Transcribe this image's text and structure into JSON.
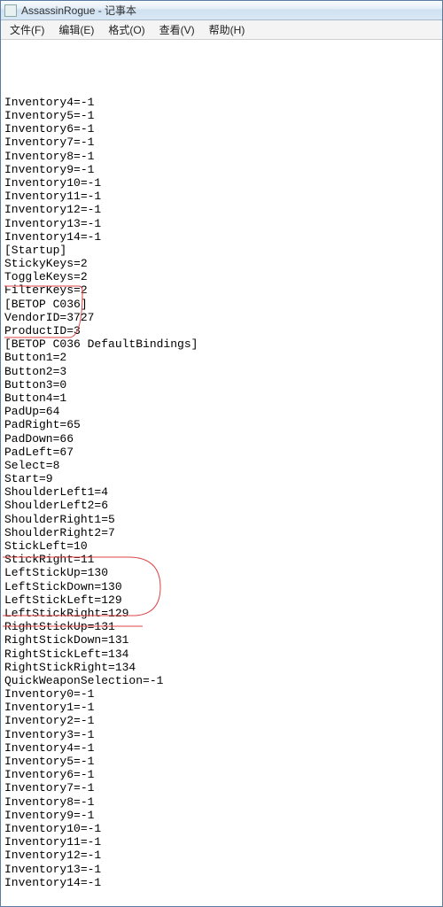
{
  "window": {
    "title": "AssassinRogue - 记事本"
  },
  "menubar": {
    "file": "文件(F)",
    "edit": "编辑(E)",
    "format": "格式(O)",
    "view": "查看(V)",
    "help": "帮助(H)"
  },
  "lines": [
    "Inventory4=-1",
    "Inventory5=-1",
    "Inventory6=-1",
    "Inventory7=-1",
    "Inventory8=-1",
    "Inventory9=-1",
    "Inventory10=-1",
    "Inventory11=-1",
    "Inventory12=-1",
    "Inventory13=-1",
    "Inventory14=-1",
    "[Startup]",
    "StickyKeys=2",
    "ToggleKeys=2",
    "FilterKeys=2",
    "[BETOP C036]",
    "VendorID=3727",
    "ProductID=3",
    "[BETOP C036 DefaultBindings]",
    "Button1=2",
    "Button2=3",
    "Button3=0",
    "Button4=1",
    "PadUp=64",
    "PadRight=65",
    "PadDown=66",
    "PadLeft=67",
    "Select=8",
    "Start=9",
    "ShoulderLeft1=4",
    "ShoulderLeft2=6",
    "ShoulderRight1=5",
    "ShoulderRight2=7",
    "StickLeft=10",
    "StickRight=11",
    "LeftStickUp=130",
    "LeftStickDown=130",
    "LeftStickLeft=129",
    "LeftStickRight=129",
    "RightStickUp=131",
    "RightStickDown=131",
    "RightStickLeft=134",
    "RightStickRight=134",
    "QuickWeaponSelection=-1",
    "Inventory0=-1",
    "Inventory1=-1",
    "Inventory2=-1",
    "Inventory3=-1",
    "Inventory4=-1",
    "Inventory5=-1",
    "Inventory6=-1",
    "Inventory7=-1",
    "Inventory8=-1",
    "Inventory9=-1",
    "Inventory10=-1",
    "Inventory11=-1",
    "Inventory12=-1",
    "Inventory13=-1",
    "Inventory14=-1",
    ""
  ]
}
